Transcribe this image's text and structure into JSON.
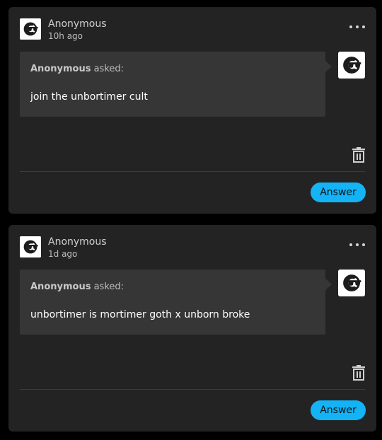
{
  "posts": [
    {
      "username": "Anonymous",
      "time_ago": "10h ago",
      "asker_name": "Anonymous",
      "asked_suffix": " asked:",
      "question": "join the unbortimer cult",
      "answer_label": "Answer"
    },
    {
      "username": "Anonymous",
      "time_ago": "1d ago",
      "asker_name": "Anonymous",
      "asked_suffix": " asked:",
      "question": "unbortimer is mortimer goth x unborn broke",
      "answer_label": "Answer"
    }
  ],
  "icons": {
    "avatar": "anonymous-sunglasses-avatar",
    "menu": "more-horizontal-icon",
    "delete": "trash-icon"
  },
  "colors": {
    "page_background": "#000000",
    "card_background": "#232323",
    "bubble_background": "#363636",
    "accent": "#13b3f5"
  }
}
